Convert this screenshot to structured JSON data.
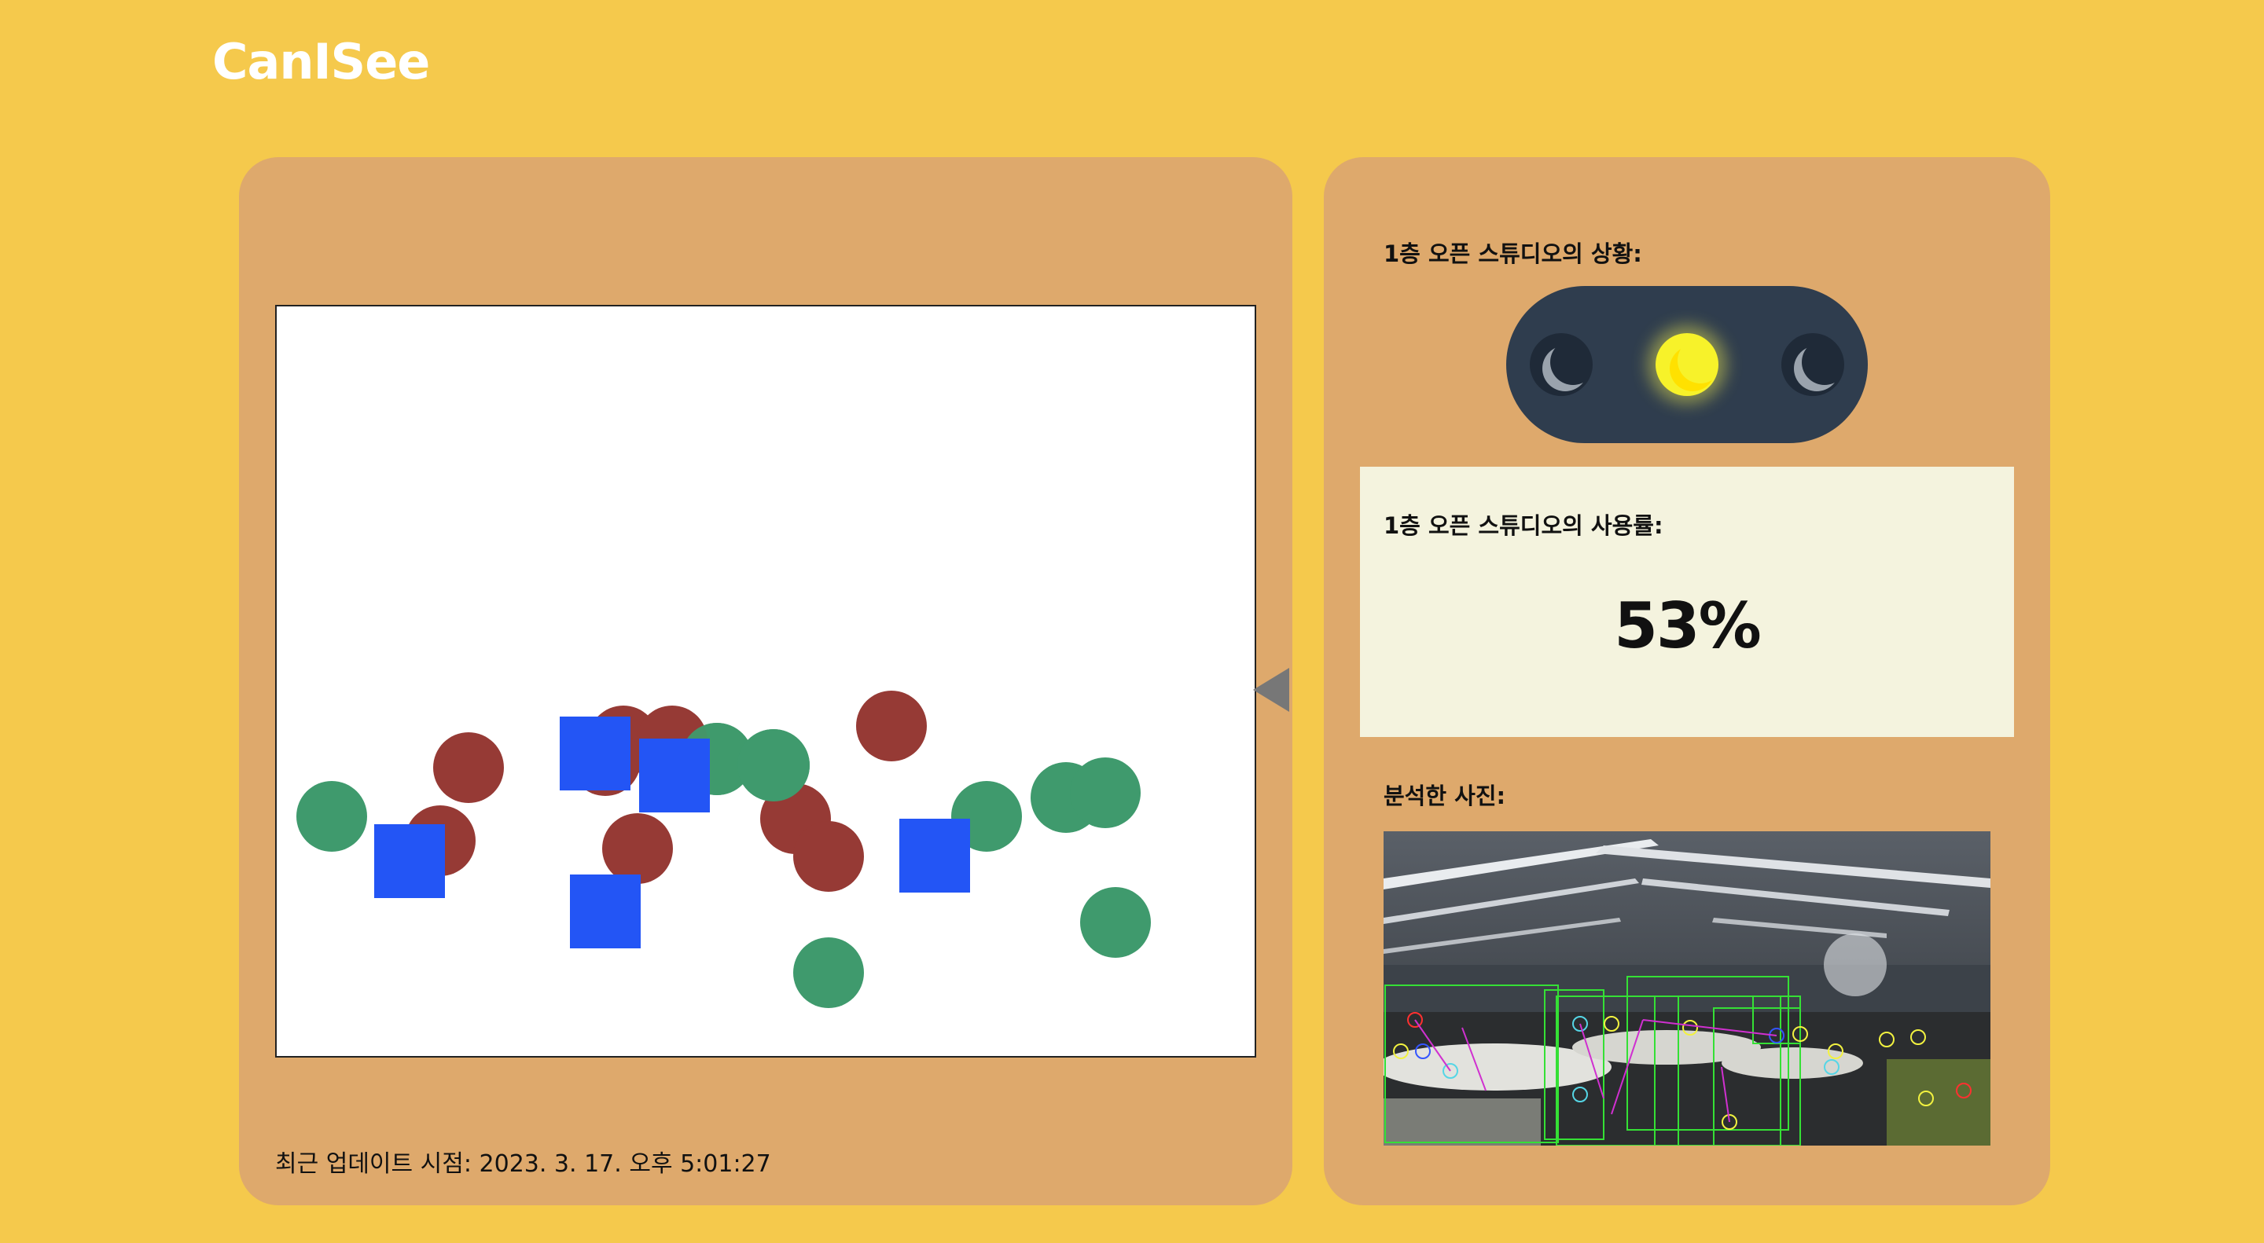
{
  "app": {
    "logo": "CanISee"
  },
  "map": {
    "nav_arrow_icon": "triangle-left-icon",
    "legend_colors": {
      "occupied_circle": "#963a35",
      "free_circle": "#3f9a6d",
      "square": "#2355f5"
    }
  },
  "update": {
    "text": "최근 업데이트 시점: 2023. 3. 17. 오후 5:01:27"
  },
  "status": {
    "heading": "1층 오픈 스튜디오의 상황:",
    "light_state": "yellow",
    "lamps": [
      "off",
      "on",
      "off"
    ]
  },
  "usage": {
    "heading": "1층 오픈 스튜디오의 사용률:",
    "value": "53%",
    "percent": 53
  },
  "photo": {
    "heading": "분석한 사진:"
  },
  "colors": {
    "background": "#f5c94c",
    "panel": "#dea96c",
    "usage_box": "#f4f3de",
    "traffic_body": "#2f3d4e",
    "lamp_on": "#f7f22a"
  }
}
